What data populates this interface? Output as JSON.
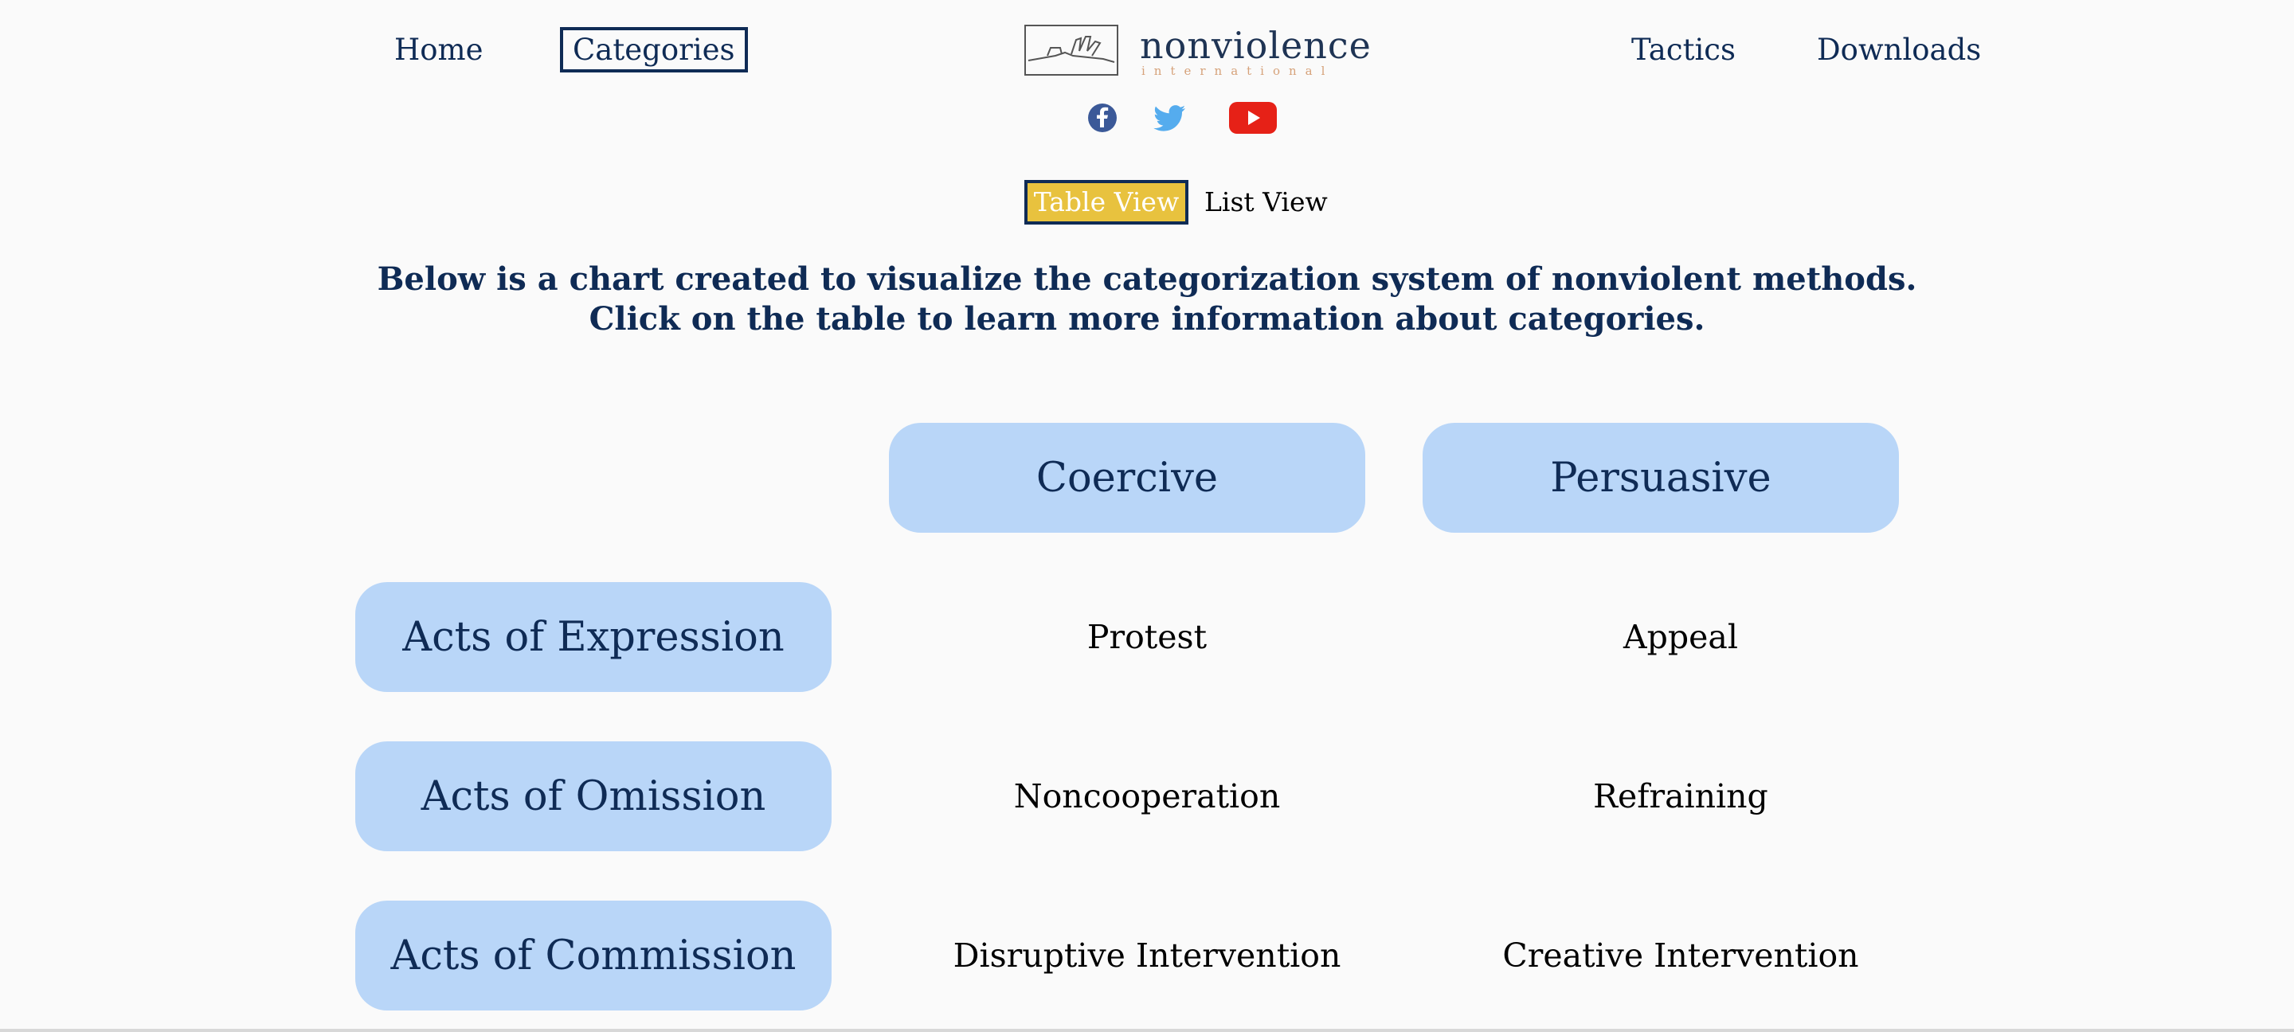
{
  "nav": {
    "home": "Home",
    "categories": "Categories",
    "tactics": "Tactics",
    "downloads": "Downloads"
  },
  "logo": {
    "wordmark": "nonviolence",
    "subtitle": "international"
  },
  "social": {
    "facebook": "facebook-icon",
    "twitter": "twitter-icon",
    "youtube": "youtube-icon"
  },
  "view_toggle": {
    "table": "Table View",
    "list": "List View"
  },
  "intro": {
    "line1": "Below is a chart created to visualize the categorization system of nonviolent methods.",
    "line2": "Click on the table to learn more information about categories."
  },
  "table": {
    "columns": [
      "Coercive",
      "Persuasive"
    ],
    "rows": [
      {
        "label": "Acts of Expression",
        "cells": [
          "Protest",
          "Appeal"
        ]
      },
      {
        "label": "Acts of Omission",
        "cells": [
          "Noncooperation",
          "Refraining"
        ]
      },
      {
        "label": "Acts of Commission",
        "cells": [
          "Disruptive Intervention",
          "Creative Intervention"
        ]
      }
    ]
  },
  "colors": {
    "navy": "#0f2b55",
    "pill": "#b9d6f8",
    "accent": "#e8c23e",
    "facebook": "#3b5998",
    "twitter": "#55acee",
    "youtube": "#e62117"
  }
}
